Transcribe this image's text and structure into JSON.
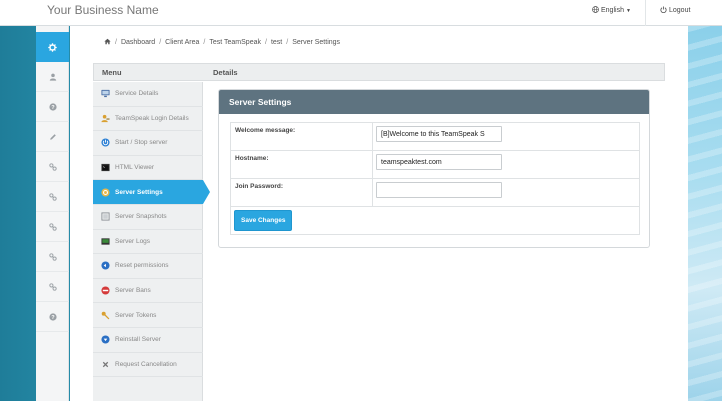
{
  "topbar": {
    "brand": "Your Business Name",
    "language": "English",
    "logout": "Logout"
  },
  "rail": {
    "items": [
      "gear-icon",
      "user-icon",
      "help-icon",
      "pencil-icon",
      "link-icon",
      "link-icon",
      "link-icon",
      "link-icon",
      "link-icon",
      "help-icon"
    ]
  },
  "breadcrumb": [
    "Dashboard",
    "Client Area",
    "Test TeamSpeak",
    "test",
    "Server Settings"
  ],
  "panel": {
    "menu_title": "Menu",
    "details_title": "Details"
  },
  "menu": {
    "items": [
      {
        "label": "Service Details",
        "icon": "monitor-icon",
        "color": "#4a6fa5"
      },
      {
        "label": "TeamSpeak Login Details",
        "icon": "key-person-icon",
        "color": "#d9a030"
      },
      {
        "label": "Start / Stop server",
        "icon": "power-icon",
        "color": "#2a7fd4"
      },
      {
        "label": "HTML Viewer",
        "icon": "terminal-icon",
        "color": "#333333"
      },
      {
        "label": "Server Settings",
        "icon": "gear-icon",
        "color": "#ffffff"
      },
      {
        "label": "Server Snapshots",
        "icon": "snapshot-icon",
        "color": "#8a8f94"
      },
      {
        "label": "Server Logs",
        "icon": "logs-icon",
        "color": "#3a8a3a"
      },
      {
        "label": "Reset permissions",
        "icon": "reset-icon",
        "color": "#2a6fc4"
      },
      {
        "label": "Server Bans",
        "icon": "ban-icon",
        "color": "#d43a3a"
      },
      {
        "label": "Server Tokens",
        "icon": "key-icon",
        "color": "#d9a030"
      },
      {
        "label": "Reinstall Server",
        "icon": "reinstall-icon",
        "color": "#2a6fc4"
      },
      {
        "label": "Request Cancellation",
        "icon": "close-icon",
        "color": "#777777"
      }
    ]
  },
  "settings": {
    "title": "Server Settings",
    "welcome_label": "Welcome message:",
    "welcome_value": "[B]Welcome to this TeamSpeak S",
    "hostname_label": "Hostname:",
    "hostname_value": "teamspeaktest.com",
    "password_label": "Join Password:",
    "password_value": "",
    "save_label": "Save Changes"
  },
  "colors": {
    "accent": "#2aa6e0",
    "box_header": "#5e7380"
  }
}
